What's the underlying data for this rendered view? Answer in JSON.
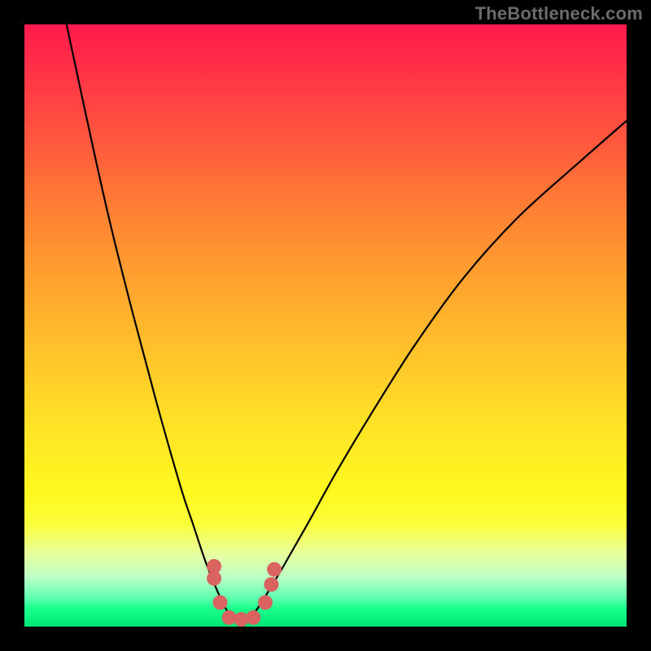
{
  "watermark": "TheBottleneck.com",
  "chart_data": {
    "type": "line",
    "title": "",
    "xlabel": "",
    "ylabel": "",
    "xlim": [
      0,
      100
    ],
    "ylim": [
      0,
      100
    ],
    "grid": false,
    "legend": false,
    "series": [
      {
        "name": "bottleneck-curve",
        "x": [
          7,
          10,
          14,
          18,
          22,
          26,
          28,
          30,
          32,
          34,
          35,
          36,
          37,
          38,
          40,
          43,
          47,
          52,
          58,
          65,
          73,
          82,
          92,
          100
        ],
        "y": [
          100,
          86,
          68,
          52,
          37,
          23,
          17,
          11,
          6,
          2,
          1,
          0,
          1,
          2,
          5,
          10,
          17,
          26,
          36,
          47,
          58,
          68,
          77,
          84
        ]
      }
    ],
    "markers": [
      {
        "x": 31.5,
        "y": 8
      },
      {
        "x": 31.5,
        "y": 10
      },
      {
        "x": 32.5,
        "y": 4
      },
      {
        "x": 34,
        "y": 1.5
      },
      {
        "x": 36,
        "y": 1.2
      },
      {
        "x": 38,
        "y": 1.5
      },
      {
        "x": 40,
        "y": 4
      },
      {
        "x": 41,
        "y": 7
      },
      {
        "x": 41.5,
        "y": 9.5
      }
    ],
    "colors": {
      "curve": "#000000",
      "marker": "#d9645f",
      "gradient_top": "#ff1a4d",
      "gradient_bottom": "#00e676"
    }
  }
}
